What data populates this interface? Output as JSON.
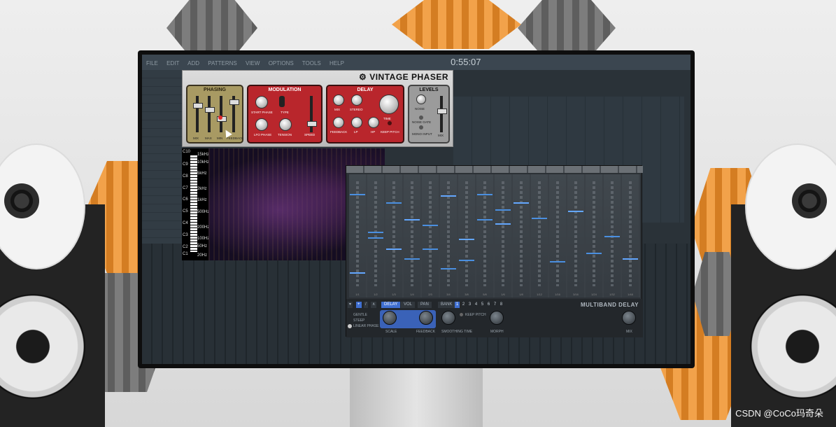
{
  "daw": {
    "menu": [
      "FILE",
      "EDIT",
      "ADD",
      "PATTERNS",
      "VIEW",
      "OPTIONS",
      "TOOLS",
      "HELP"
    ],
    "time": "0:55:07"
  },
  "vintage_phaser": {
    "title": "VINTAGE PHASER",
    "phasing": {
      "title": "PHASING",
      "labels": [
        "MIX",
        "MAX",
        "MIN",
        "FEEDBACK"
      ]
    },
    "modulation": {
      "title": "MODULATION",
      "labels": [
        "START PHASE",
        "TYPE",
        "LFO PHASE",
        "TENSION",
        "SPEED"
      ]
    },
    "delay": {
      "title": "DELAY",
      "labels": [
        "MIX",
        "STEREO",
        "TIME",
        "FEEDBACK",
        "LP",
        "HP",
        "KEEP PITCH"
      ]
    },
    "levels": {
      "title": "LEVELS",
      "labels": [
        "NOISE",
        "NOISE GATE",
        "MONO INPUT",
        "MIX"
      ]
    }
  },
  "spectrum": {
    "notes": [
      "C10",
      "C9",
      "C8",
      "C7",
      "C6",
      "C5",
      "C4",
      "C3",
      "C2",
      "C1"
    ],
    "freqs": [
      "15kHz",
      "10kHz",
      "5kHz",
      "2kHz",
      "1kHz",
      "500Hz",
      "200Hz",
      "100Hz",
      "50Hz",
      "20Hz"
    ]
  },
  "multiband_delay": {
    "title": "MULTIBAND DELAY",
    "tabs": [
      "DELAY",
      "VOL",
      "PAN"
    ],
    "bank_label": "BANK",
    "banks": [
      "1",
      "2",
      "3",
      "4",
      "5",
      "6",
      "7",
      "8"
    ],
    "modes": [
      "GENTLE",
      "STEEP",
      "LINEAR PHASE"
    ],
    "controls": [
      "SCALE",
      "FEEDBACK",
      "SMOOTHING TIME",
      "KEEP PITCH",
      "MORPH",
      "MIX"
    ],
    "band_labels": [
      "1/1",
      "1/2",
      "1/3",
      "1/4",
      "2/3",
      "3/4",
      "3/8",
      "5/8",
      "1/6",
      "1/8",
      "1/12",
      "1/16",
      "3/16",
      "1/24",
      "1/32",
      "1/48"
    ]
  },
  "watermark": "CSDN @CoCo玛奇朵"
}
